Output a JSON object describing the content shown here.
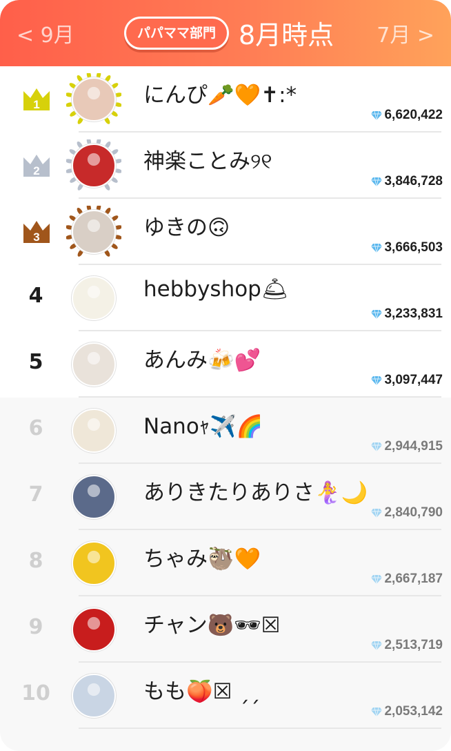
{
  "header": {
    "prev_month": "< 9月",
    "next_month": "7月 >",
    "category": "パパママ部門",
    "period_title": "8月時点"
  },
  "colors": {
    "header_start": "#ff5f4a",
    "header_end": "#ffa25a",
    "gold": "#d7d10a",
    "silver": "#b7bfcc",
    "bronze": "#a0561b",
    "gem": "#5bb8ee"
  },
  "rankings": [
    {
      "rank": "1",
      "name": "にんぴ🥕🧡✝︎:*",
      "score": "6,620,422",
      "badge": "gold-crown",
      "avatar_color": "#e8c9b8"
    },
    {
      "rank": "2",
      "name": "神楽ことみ୨୧",
      "score": "3,846,728",
      "badge": "silver-crown",
      "avatar_color": "#c72a2a"
    },
    {
      "rank": "3",
      "name": "ゆきの🙃",
      "score": "3,666,503",
      "badge": "bronze-crown",
      "avatar_color": "#d9cfc6"
    },
    {
      "rank": "4",
      "name": "hebbyshop🛎",
      "score": "3,233,831",
      "badge": "",
      "avatar_color": "#f4f1e6"
    },
    {
      "rank": "5",
      "name": "あんみ🍻💕",
      "score": "3,097,447",
      "badge": "",
      "avatar_color": "#e9e2da"
    },
    {
      "rank": "6",
      "name": "Nanoｬ✈️🌈",
      "score": "2,944,915",
      "badge": "",
      "avatar_color": "#efe7d8"
    },
    {
      "rank": "7",
      "name": "ありきたりありさ🧜‍♀️🌙",
      "score": "2,840,790",
      "badge": "",
      "avatar_color": "#5b6a8a"
    },
    {
      "rank": "8",
      "name": "ちゃみ🦥🧡",
      "score": "2,667,187",
      "badge": "",
      "avatar_color": "#f1c51f"
    },
    {
      "rank": "9",
      "name": "チャン🐻🕶☒",
      "score": "2,513,719",
      "badge": "",
      "avatar_color": "#c81d1d"
    },
    {
      "rank": "10",
      "name": "もも🍑☒ ˏˏ",
      "score": "2,053,142",
      "badge": "",
      "avatar_color": "#c9d5e4"
    }
  ]
}
